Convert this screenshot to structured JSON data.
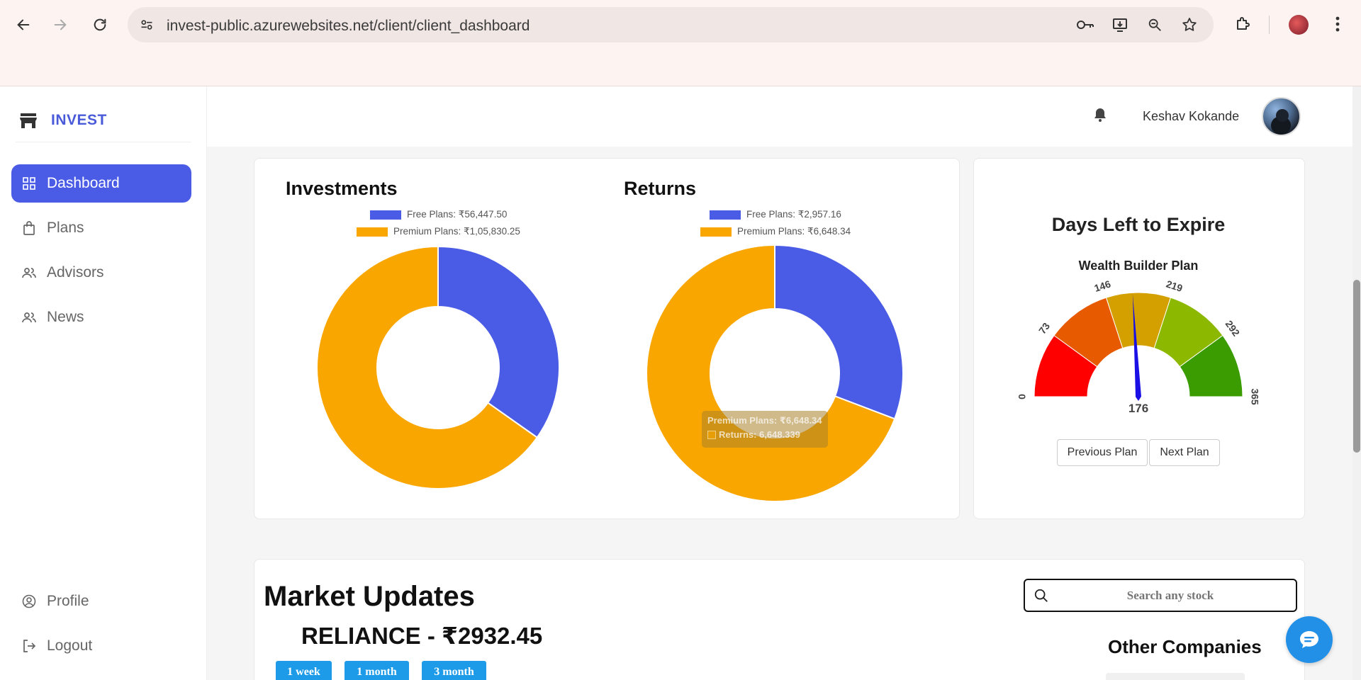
{
  "browser": {
    "url": "invest-public.azurewebsites.net/client/client_dashboard"
  },
  "sidebar": {
    "brand": "INVEST",
    "items": [
      {
        "label": "Dashboard",
        "icon": "grid-icon"
      },
      {
        "label": "Plans",
        "icon": "bag-icon"
      },
      {
        "label": "Advisors",
        "icon": "users-icon"
      },
      {
        "label": "News",
        "icon": "users-icon"
      }
    ],
    "bottom_items": [
      {
        "label": "Profile",
        "icon": "user-circle-icon"
      },
      {
        "label": "Logout",
        "icon": "logout-icon"
      }
    ]
  },
  "header": {
    "username": "Keshav Kokande"
  },
  "charts": {
    "investments": {
      "title": "Investments",
      "legend": [
        "Free Plans: ₹56,447.50",
        "Premium Plans: ₹1,05,830.25"
      ]
    },
    "returns": {
      "title": "Returns",
      "legend": [
        "Free Plans: ₹2,957.16",
        "Premium Plans: ₹6,648.34"
      ],
      "tooltip_title": "Premium Plans: ₹6,648.34",
      "tooltip_body": "Returns: 6,648.339"
    }
  },
  "chart_data": [
    {
      "type": "pie",
      "title": "Investments",
      "categories": [
        "Free Plans",
        "Premium Plans"
      ],
      "values": [
        56447.5,
        105830.25
      ],
      "colors": [
        "#4a5be6",
        "#f9a600"
      ]
    },
    {
      "type": "pie",
      "title": "Returns",
      "categories": [
        "Free Plans",
        "Premium Plans"
      ],
      "values": [
        2957.16,
        6648.34
      ],
      "colors": [
        "#4a5be6",
        "#f9a600"
      ]
    }
  ],
  "gauge": {
    "title": "Days Left to Expire",
    "plan_name": "Wealth Builder Plan",
    "value": 176,
    "min": 0,
    "max": 365,
    "ticks": [
      "0",
      "73",
      "146",
      "219",
      "292",
      "365"
    ],
    "value_label": "176",
    "prev_label": "Previous Plan",
    "next_label": "Next Plan",
    "band_colors": [
      "#ff0000",
      "#e85a00",
      "#d4a000",
      "#8db800",
      "#3a9c00"
    ]
  },
  "market": {
    "title": "Market Updates",
    "stock_line": "RELIANCE - ₹2932.45",
    "ranges": [
      "1 week",
      "1 month",
      "3 month"
    ],
    "search_placeholder": "Search any stock",
    "other_title": "Other Companies"
  },
  "colors": {
    "accent": "#4a5be6",
    "premium": "#f9a600",
    "button_blue": "#1e9be8"
  }
}
